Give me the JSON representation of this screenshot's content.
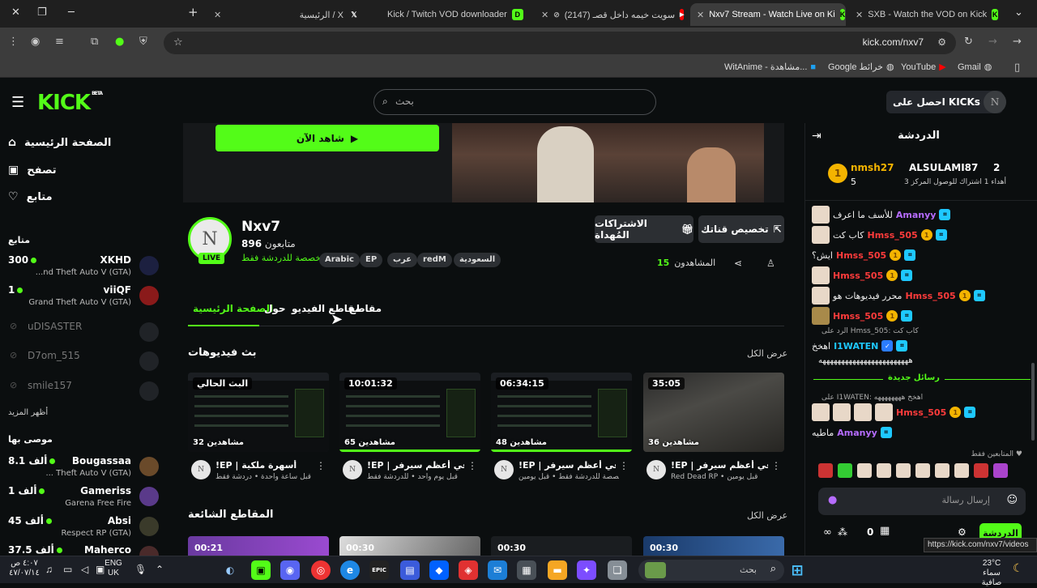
{
  "browser": {
    "tabs": [
      {
        "label": "الرئيسية / X",
        "icon": "x-logo-icon"
      },
      {
        "label": "Kick / Twitch VOD downloader",
        "icon": "d-logo-icon"
      },
      {
        "label": "(2147) سويت خيمه داخل قصـ",
        "icon": "youtube-icon"
      },
      {
        "label": "Nxv7 Stream - Watch Live on Ki",
        "icon": "kick-icon"
      },
      {
        "label": "SXB - Watch the VOD on Kick",
        "icon": "kick-icon"
      }
    ],
    "url": "kick.com/nxv7",
    "bookmarks": [
      {
        "label": "Gmail",
        "icon": "google-icon"
      },
      {
        "label": "YouTube",
        "icon": "youtube-icon"
      },
      {
        "label": "Google خرائط",
        "icon": "maps-icon"
      },
      {
        "label": "WitAnime - مشاهدة...",
        "icon": "witanime-icon"
      }
    ],
    "status_url": "https://kick.com/nxv7/videos"
  },
  "header": {
    "logo": "KICK",
    "logo_sup": "BETA",
    "search_placeholder": "بحث",
    "get_kicks": "احصل على KICKs"
  },
  "sidebar": {
    "nav": [
      {
        "label": "الصفحة الرئيسية",
        "icon": "home-icon"
      },
      {
        "label": "تصفح",
        "icon": "browse-icon"
      },
      {
        "label": "متابع",
        "icon": "heart-icon"
      }
    ],
    "following_heading": "متابع",
    "following": [
      {
        "name": "XKHD",
        "viewers": "300",
        "game": "...nd Theft Auto V (GTA)",
        "live": true
      },
      {
        "name": "viiQF",
        "viewers": "1",
        "game": "Grand Theft Auto V (GTA)",
        "live": true
      },
      {
        "name": "uDISASTER",
        "live": false
      },
      {
        "name": "D7om_515",
        "live": false
      },
      {
        "name": "smile157",
        "live": false
      }
    ],
    "show_more": "أظهر المزيد",
    "recommended_heading": "موصى بها",
    "recommended": [
      {
        "name": "Bougassaa",
        "viewers": "8.1 ألف",
        "game": "... Theft Auto V (GTA)"
      },
      {
        "name": "Gameriss",
        "viewers": "1 ألف",
        "game": "Garena Free Fire"
      },
      {
        "name": "Absi",
        "viewers": "45 ألف",
        "game": "Respect RP (GTA)"
      },
      {
        "name": "Maherco",
        "viewers": "37.5 ألف",
        "game": ""
      }
    ]
  },
  "channel": {
    "watch_now": "شاهد الآن",
    "name": "Nxv7",
    "followers": "896",
    "followers_label": "متابعون",
    "chat_mode": "مخصصة للدردشة فقط",
    "live_badge": "LIVE",
    "tags": [
      "السعودية",
      "redM",
      "عرب",
      "EP",
      "Arabic"
    ],
    "customize_button": "تخصيص قناتك",
    "gift_button": "الاشتراكات المُهداة",
    "viewers_label": "المشاهدون",
    "viewers": "15",
    "tabs": [
      "الصفحة الرئيسية",
      "حول",
      "مقاطع الفيديو",
      "مقاطع"
    ]
  },
  "videos": {
    "heading": "بث فيديوهات",
    "view_all": "عرض الكل",
    "items": [
      {
        "duration": "35:05",
        "viewers": "36 مشاهدين",
        "title": "!EP | في أعظم سيرفر",
        "sub": "Red Dead RP • قبل يومين",
        "thumb": "game"
      },
      {
        "duration": "06:34:15",
        "viewers": "48 مشاهدين",
        "title": "!EP | في أعظم سيرفر",
        "sub": "مخصصة للدردشة فقط • قبل يومين",
        "thumb": "screen"
      },
      {
        "duration": "10:01:32",
        "viewers": "65 مشاهدين",
        "title": "!EP | في أعظم سيرفر",
        "sub": "قبل يوم واحد • للدردشة فقط",
        "thumb": "screen"
      },
      {
        "duration": "البث الحالي",
        "viewers": "32 مشاهدين",
        "title": "!EP | أسهرة ملكية",
        "sub": "قبل ساعة واحدة • دردشة فقط",
        "thumb": "screen"
      }
    ]
  },
  "clips": {
    "heading": "المقاطع الشائعة",
    "view_all": "عرض الكل",
    "items": [
      {
        "duration": "00:30"
      },
      {
        "duration": "00:30"
      },
      {
        "duration": "00:30"
      },
      {
        "duration": "00:21"
      }
    ]
  },
  "chat": {
    "title": "الدردشة",
    "leaderboard": {
      "first": {
        "name": "nmsh27",
        "count": "5"
      },
      "second": {
        "name": "ALSULAMI87",
        "count": "2"
      },
      "sub_text": "أهداء 1 اشتراك للوصول المركز 3"
    },
    "messages": [
      {
        "user": "Amanyy",
        "text": "للأسف ما اعرف",
        "color": "#b66cff"
      },
      {
        "user": "Hmss_505",
        "text": "كاب كت",
        "color": "#ff3b3b"
      },
      {
        "user": "Hmss_505",
        "text": "ايش؟",
        "color": "#ff3b3b"
      },
      {
        "user": "Hmss_505",
        "text": "",
        "color": "#ff3b3b"
      },
      {
        "user": "Hmss_505",
        "text": "محرر فيديوهات هو",
        "color": "#ff3b3b"
      },
      {
        "user": "Hmss_505",
        "text": "",
        "color": "#ff3b3b"
      },
      {
        "user": "I1WATEN",
        "text": "اهخخ",
        "color": "#1ec8ff",
        "reply": "الرد على Hmss_505: كاب كت"
      }
    ],
    "long_text": "ههههههههههههههههههههههههه",
    "new_messages": "رسائل جديدة",
    "after": [
      {
        "user": "Hmss_505",
        "text": "",
        "color": "#ff3b3b",
        "reply": "على I1WATEN: اهخخ ههههههههه"
      },
      {
        "user": "Amanyy",
        "text": "ماطيه",
        "color": "#b66cff"
      }
    ],
    "followers_only": "المتابعين فقط",
    "input_placeholder": "إرسال رسالة",
    "send_label": "الدردشة",
    "points": "0"
  },
  "taskbar": {
    "search_placeholder": "بحث",
    "weather_temp": "23°C",
    "weather_desc": "سماء صافية",
    "lang": "ENG",
    "lang2": "UK",
    "time": "٤:٠٧ ص",
    "date": "٤٧/٠٧/١٤"
  }
}
